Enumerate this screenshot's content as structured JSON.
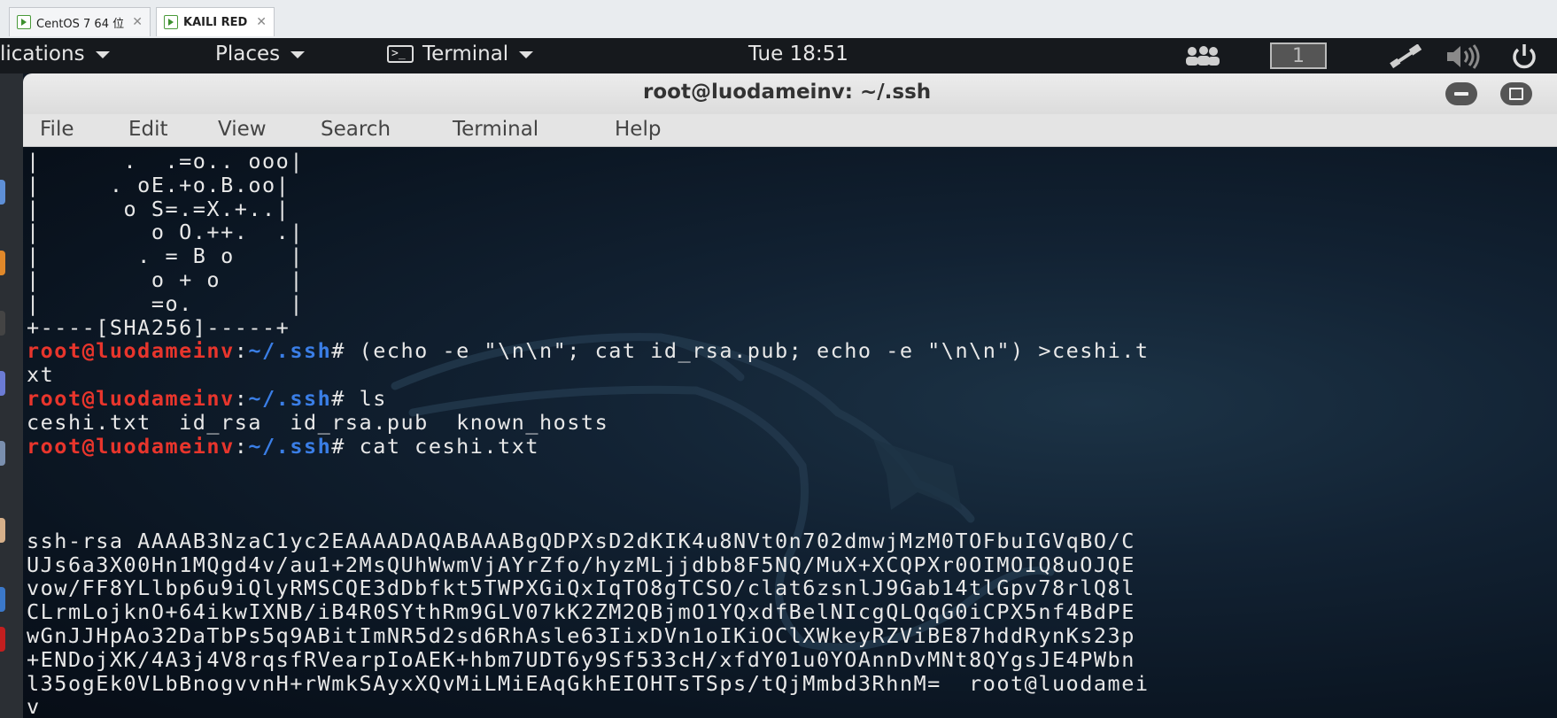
{
  "vm_tabs": [
    {
      "label": "CentOS 7 64 位"
    },
    {
      "label": "KAILI RED"
    }
  ],
  "topbar": {
    "applications": "lications",
    "places": "Places",
    "terminal": "Terminal",
    "clock": "Tue 18:51",
    "workspace": "1"
  },
  "window": {
    "title": "root@luodameinv: ~/.ssh",
    "menu": [
      "File",
      "Edit",
      "View",
      "Search",
      "Terminal",
      "Help"
    ]
  },
  "terminal": {
    "prompt_user": "root@luodameinv",
    "prompt_path": "~/.ssh",
    "lines": [
      {
        "type": "out",
        "text": "|      .  .=o.. ooo|"
      },
      {
        "type": "out",
        "text": "|     . oE.+o.B.oo|"
      },
      {
        "type": "out",
        "text": "|      o S=.=X.+..|"
      },
      {
        "type": "out",
        "text": "|        o O.++.  .|"
      },
      {
        "type": "out",
        "text": "|       . = B o    |"
      },
      {
        "type": "out",
        "text": "|        o + o     |"
      },
      {
        "type": "out",
        "text": "|        =o.       |"
      },
      {
        "type": "out",
        "text": "+----[SHA256]-----+"
      },
      {
        "type": "cmd",
        "text": " (echo -e \"\\n\\n\"; cat id_rsa.pub; echo -e \"\\n\\n\") >ceshi.t"
      },
      {
        "type": "out",
        "text": "xt"
      },
      {
        "type": "cmd",
        "text": " ls"
      },
      {
        "type": "out",
        "text": "ceshi.txt  id_rsa  id_rsa.pub  known_hosts"
      },
      {
        "type": "cmd",
        "text": " cat ceshi.txt"
      },
      {
        "type": "out",
        "text": ""
      },
      {
        "type": "out",
        "text": ""
      },
      {
        "type": "out",
        "text": ""
      },
      {
        "type": "out",
        "text": "ssh-rsa AAAAB3NzaC1yc2EAAAADAQABAAABgQDPXsD2dKIK4u8NVt0n702dmwjMzM0TOFbuIGVqBO/C"
      },
      {
        "type": "out",
        "text": "UJs6a3X00Hn1MQgd4v/au1+2MsQUhWwmVjAYrZfo/hyzMLjjdbb8F5NQ/MuX+XCQPXr0OIMOIQ8uOJQE"
      },
      {
        "type": "out",
        "text": "vow/FF8YLlbp6u9iQlyRMSCQE3dDbfkt5TWPXGiQxIqTO8gTCSO/clat6zsnlJ9Gab14tlGpv78rlQ8l"
      },
      {
        "type": "out",
        "text": "CLrmLojknO+64ikwIXNB/iB4R0SYthRm9GLV07kK2ZM2QBjmO1YQxdfBelNIcgQLQqG0iCPX5nf4BdPE"
      },
      {
        "type": "out",
        "text": "wGnJJHpAo32DaTbPs5q9ABitImNR5d2sd6RhAsle63IixDVn1oIKiOClXWkeyRZViBE87hddRynKs23p"
      },
      {
        "type": "out",
        "text": "+ENDojXK/4A3j4V8rqsfRVearpIoAEK+hbm7UDT6y9Sf533cH/xfdY01u0YOAnnDvMNt8QYgsJE4PWbn"
      },
      {
        "type": "out",
        "text": "l35ogEk0VLbBnogvvnH+rWmkSAyxXQvMiLMiEAqGkhEIOHTsTSps/tQjMmbd3RhnM=  root@luodamei"
      },
      {
        "type": "out",
        "text": "v"
      }
    ]
  }
}
